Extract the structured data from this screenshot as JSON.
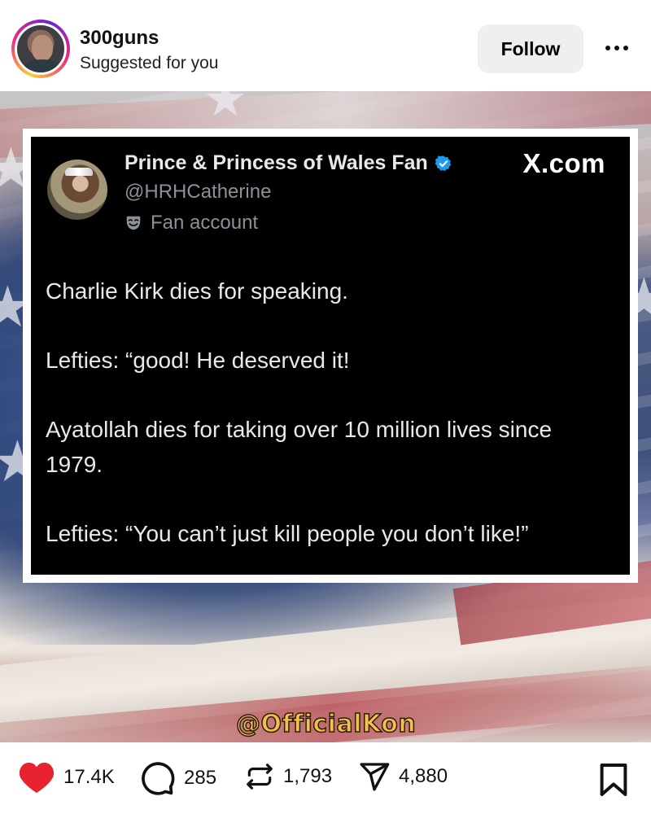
{
  "post": {
    "username": "300guns",
    "subtitle": "Suggested for you",
    "follow_label": "Follow"
  },
  "tweet": {
    "display_name": "Prince & Princess of Wales Fan",
    "handle": "@HRHCatherine",
    "label": "Fan account",
    "source": "X.com",
    "lines": [
      "Charlie Kirk dies for speaking.",
      "Lefties: “good! He deserved it!",
      "Ayatollah dies for taking over 10 million lives since 1979.",
      "Lefties: “You can’t just kill people you don’t like!”"
    ]
  },
  "watermark": "@OfficialKon",
  "actions": {
    "likes": "17.4K",
    "comments": "285",
    "reposts": "1,793",
    "shares": "4,880"
  },
  "colors": {
    "like": "#e8232f",
    "verified": "#1d9bf0",
    "follow_bg": "#efefef"
  }
}
